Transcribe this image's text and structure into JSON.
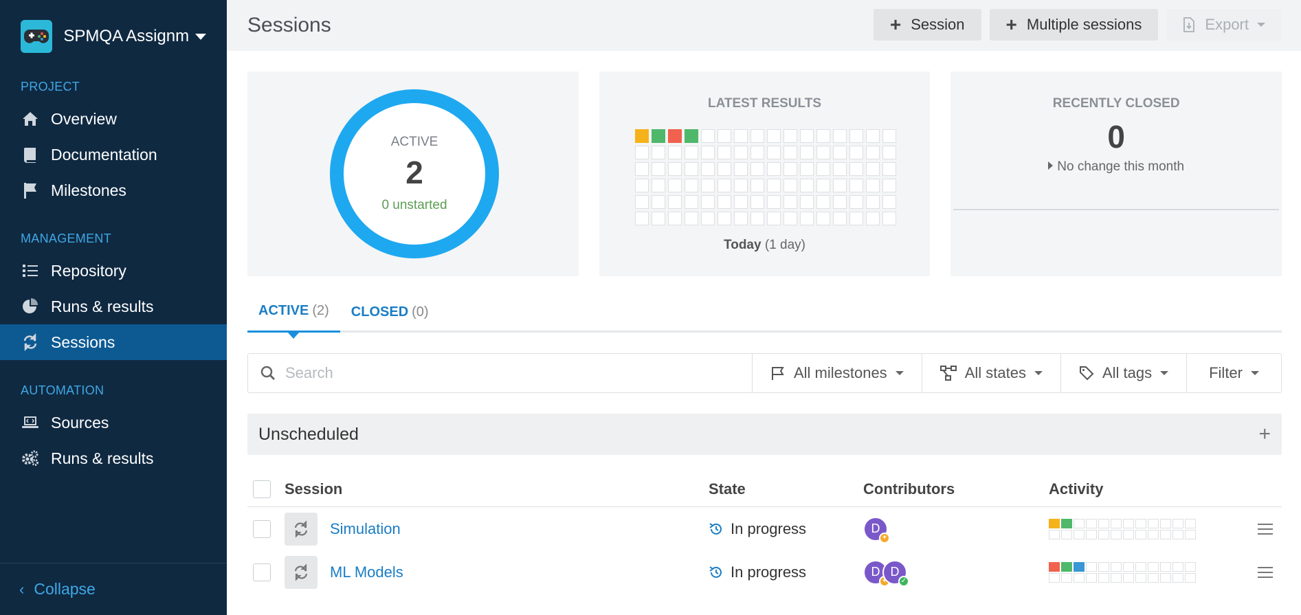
{
  "project": {
    "name": "SPMQA Assignm..."
  },
  "nav": {
    "sections": [
      {
        "title": "PROJECT",
        "items": [
          {
            "label": "Overview",
            "icon": "home-icon"
          },
          {
            "label": "Documentation",
            "icon": "book-icon"
          },
          {
            "label": "Milestones",
            "icon": "flag-icon"
          }
        ]
      },
      {
        "title": "MANAGEMENT",
        "items": [
          {
            "label": "Repository",
            "icon": "list-icon"
          },
          {
            "label": "Runs & results",
            "icon": "pie-chart-icon"
          },
          {
            "label": "Sessions",
            "icon": "sessions-icon",
            "active": true
          }
        ]
      },
      {
        "title": "AUTOMATION",
        "items": [
          {
            "label": "Sources",
            "icon": "laptop-code-icon"
          },
          {
            "label": "Runs & results",
            "icon": "gears-icon"
          }
        ]
      }
    ],
    "collapse_label": "Collapse"
  },
  "header": {
    "title": "Sessions",
    "buttons": {
      "session": "Session",
      "multiple": "Multiple sessions",
      "export": "Export"
    }
  },
  "cards": {
    "active": {
      "label": "ACTIVE",
      "value": "2",
      "sub": "0 unstarted",
      "ring_color": "#1ea8f0"
    },
    "latest": {
      "title": "LATEST RESULTS",
      "footer_bold": "Today",
      "footer_rest": " (1 day)",
      "cells": [
        "#f6b21b",
        "#4fb86b",
        "#f0624d",
        "#4fb86b"
      ]
    },
    "closed": {
      "title": "RECENTLY CLOSED",
      "value": "0",
      "sub": "No change this month"
    }
  },
  "tabs": [
    {
      "label": "ACTIVE",
      "count": "(2)",
      "active": true
    },
    {
      "label": "CLOSED",
      "count": "(0)",
      "active": false
    }
  ],
  "filters": {
    "search_placeholder": "Search",
    "milestones": "All milestones",
    "states": "All states",
    "tags": "All tags",
    "filter": "Filter"
  },
  "group": {
    "title": "Unscheduled"
  },
  "table": {
    "headers": {
      "session": "Session",
      "state": "State",
      "contributors": "Contributors",
      "activity": "Activity"
    },
    "rows": [
      {
        "name": "Simulation",
        "state": "In progress",
        "contributors": [
          "D"
        ],
        "badges": [
          "add"
        ],
        "activity": [
          "#f6b21b",
          "#4fb86b"
        ]
      },
      {
        "name": "ML Models",
        "state": "In progress",
        "contributors": [
          "D",
          "D"
        ],
        "badges": [
          "add",
          "ok"
        ],
        "activity": [
          "#f0624d",
          "#4fb86b",
          "#3a96d4"
        ]
      }
    ]
  }
}
